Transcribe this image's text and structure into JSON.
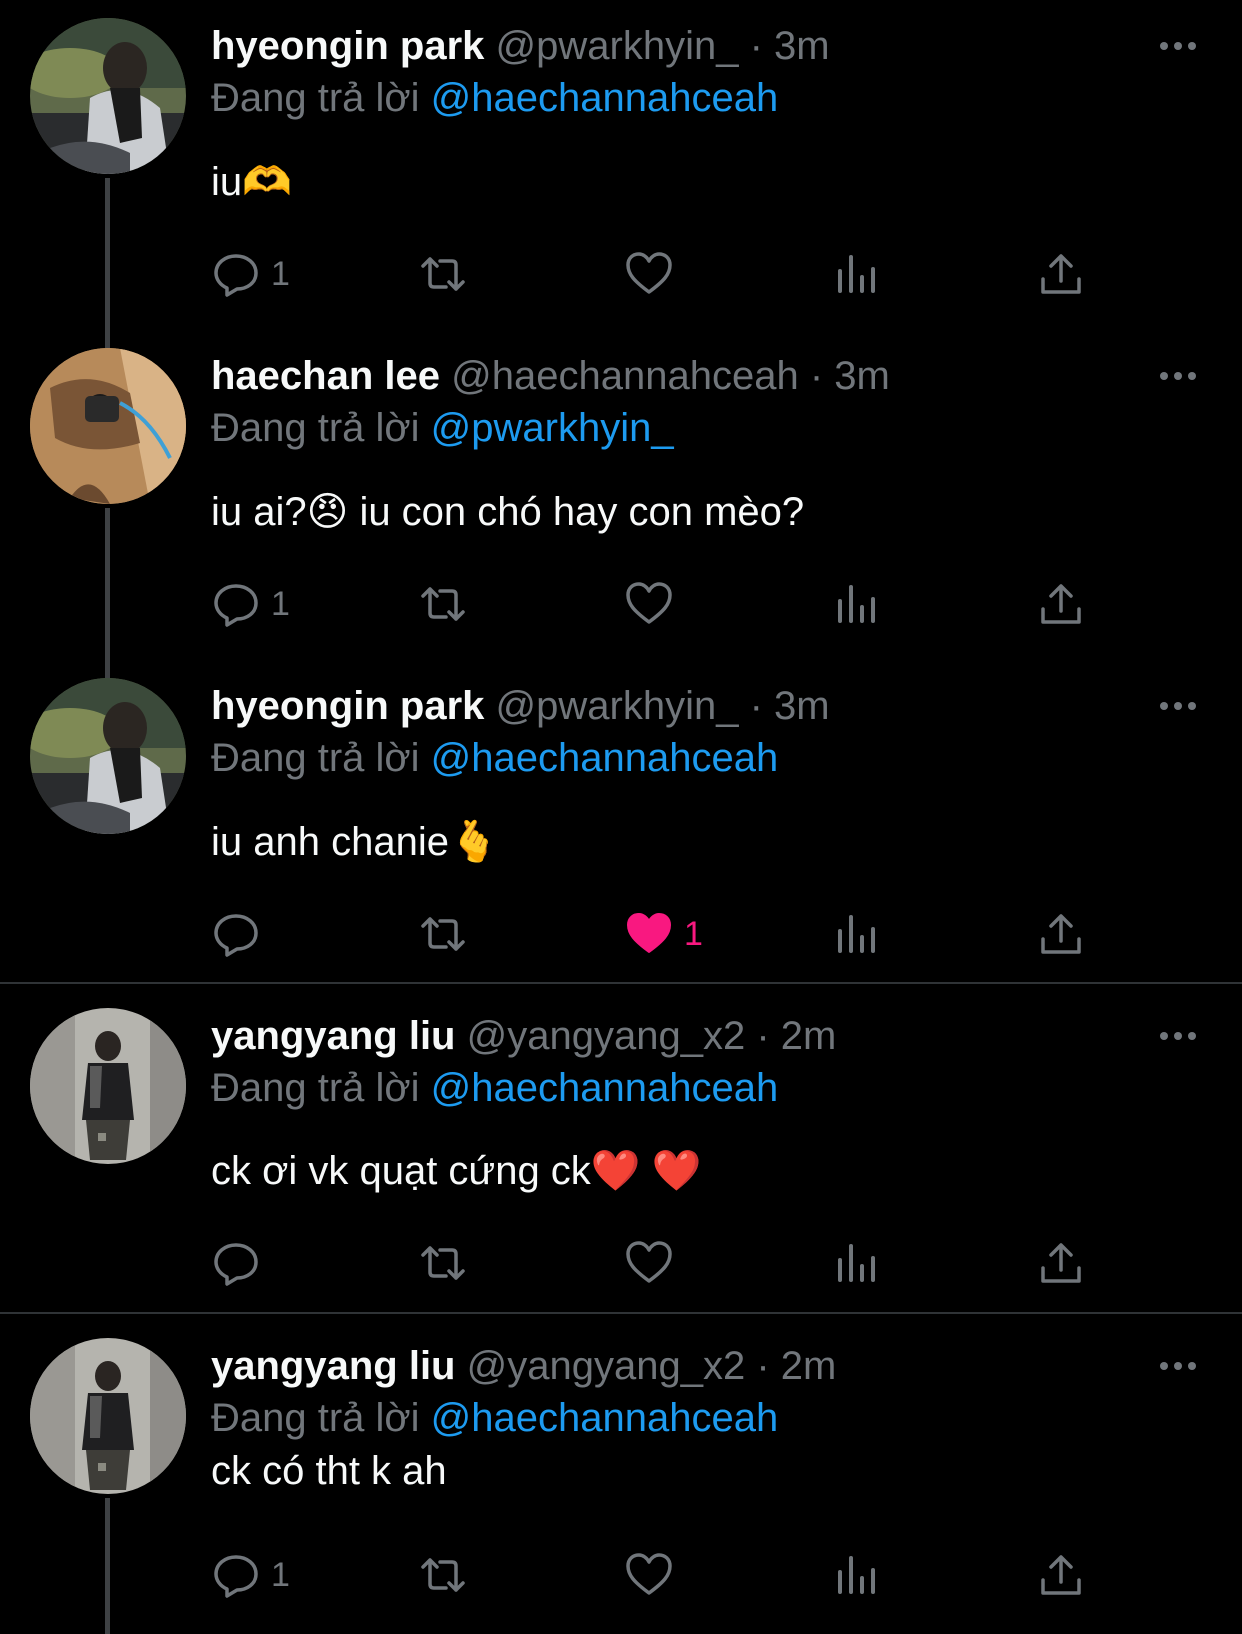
{
  "tweets": [
    {
      "name": "hyeongin park",
      "handle": "@pwarkhyin_",
      "time": "3m",
      "reply_prefix": "Đang trả lời",
      "reply_to": "@haechannahceah",
      "text": "iu🫶",
      "reply_count": "1",
      "like_count": "",
      "liked": false,
      "avatar": "avatar-hyeongin"
    },
    {
      "name": "haechan lee",
      "handle": "@haechannahceah",
      "time": "3m",
      "reply_prefix": "Đang trả lời",
      "reply_to": "@pwarkhyin_",
      "text": "iu ai?😠 iu con chó hay con mèo?",
      "reply_count": "1",
      "like_count": "",
      "liked": false,
      "avatar": "avatar-haechan"
    },
    {
      "name": "hyeongin park",
      "handle": "@pwarkhyin_",
      "time": "3m",
      "reply_prefix": "Đang trả lời",
      "reply_to": "@haechannahceah",
      "text": "iu anh chanie🫰",
      "reply_count": "",
      "like_count": "1",
      "liked": true,
      "avatar": "avatar-hyeongin"
    },
    {
      "name": "yangyang liu",
      "handle": "@yangyang_x2",
      "time": "2m",
      "reply_prefix": "Đang trả lời",
      "reply_to": "@haechannahceah",
      "text": "ck ơi vk quạt cứng ck❤️ ❤️",
      "reply_count": "",
      "like_count": "",
      "liked": false,
      "avatar": "avatar-yangyang"
    },
    {
      "name": "yangyang liu",
      "handle": "@yangyang_x2",
      "time": "2m",
      "reply_prefix": "Đang trả lời",
      "reply_to": "@haechannahceah",
      "text": "ck có tht k ah",
      "reply_count": "1",
      "like_count": "",
      "liked": false,
      "avatar": "avatar-yangyang"
    }
  ],
  "separator": "·",
  "icons": {
    "reply": "reply-icon",
    "retweet": "retweet-icon",
    "like": "heart-icon",
    "views": "views-icon",
    "share": "share-icon",
    "more": "more-icon"
  },
  "colors": {
    "background": "#000000",
    "name": "#f7f9f9",
    "muted": "#71767b",
    "mention": "#1d9bf0",
    "liked": "#f91880",
    "divider": "#2f3336"
  }
}
